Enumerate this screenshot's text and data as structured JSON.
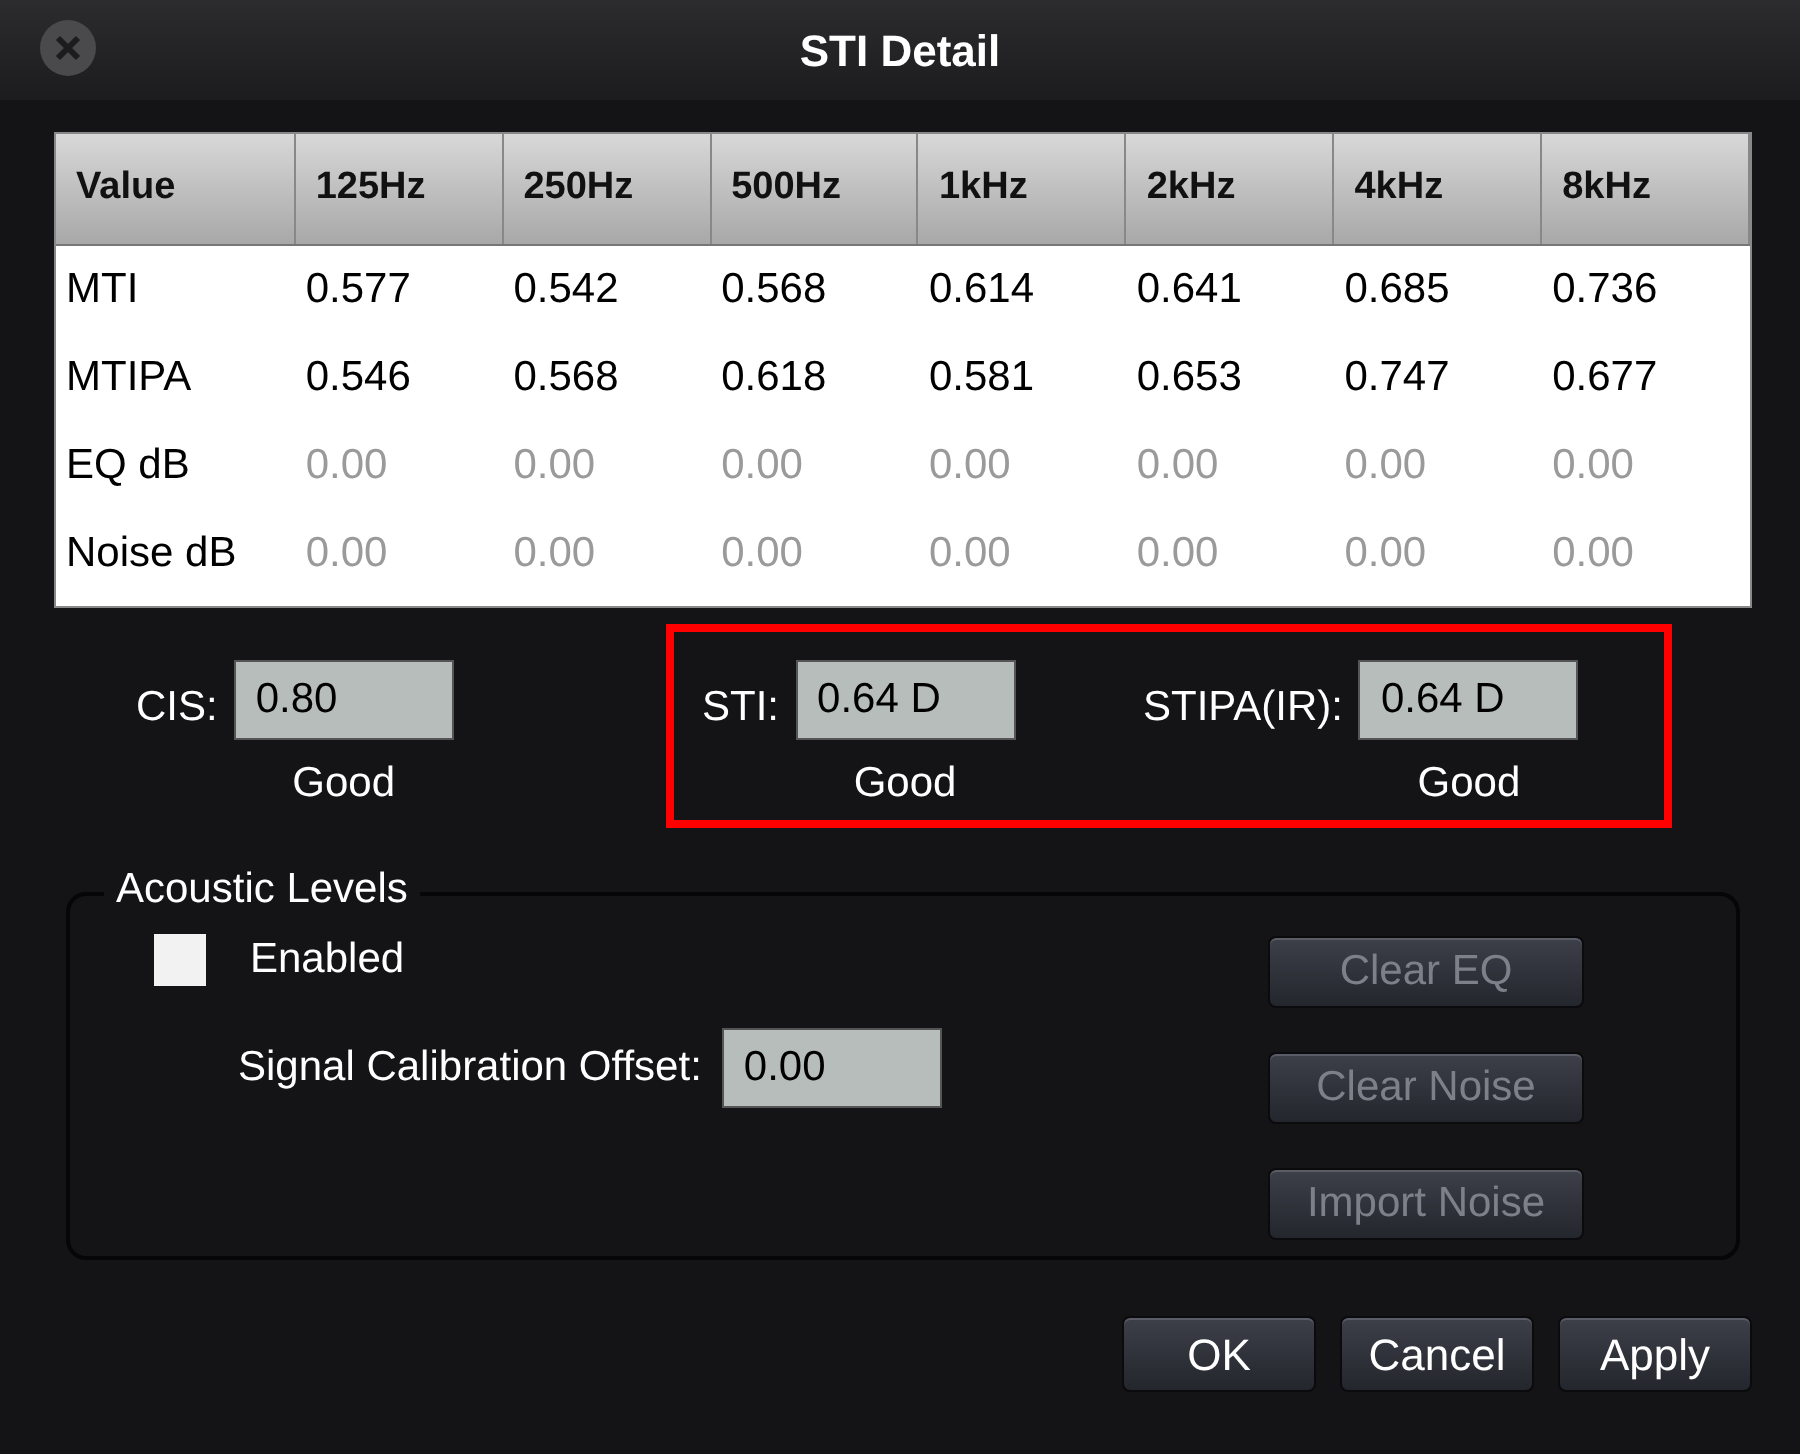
{
  "window": {
    "title": "STI Detail"
  },
  "table": {
    "columns": [
      "Value",
      "125Hz",
      "250Hz",
      "500Hz",
      "1kHz",
      "2kHz",
      "4kHz",
      "8kHz"
    ],
    "rows": [
      {
        "disabled": false,
        "cells": [
          "MTI",
          "0.577",
          "0.542",
          "0.568",
          "0.614",
          "0.641",
          "0.685",
          "0.736"
        ]
      },
      {
        "disabled": false,
        "cells": [
          "MTIPA",
          "0.546",
          "0.568",
          "0.618",
          "0.581",
          "0.653",
          "0.747",
          "0.677"
        ]
      },
      {
        "disabled": true,
        "cells": [
          "EQ dB",
          "0.00",
          "0.00",
          "0.00",
          "0.00",
          "0.00",
          "0.00",
          "0.00"
        ]
      },
      {
        "disabled": true,
        "cells": [
          "Noise dB",
          "0.00",
          "0.00",
          "0.00",
          "0.00",
          "0.00",
          "0.00",
          "0.00"
        ]
      }
    ]
  },
  "metric_groups": [
    {
      "highlighted": false,
      "items": [
        {
          "label": "CIS:",
          "value": "0.80",
          "rating": "Good"
        }
      ]
    },
    {
      "highlighted": true,
      "items": [
        {
          "label": "STI:",
          "value": "0.64 D",
          "rating": "Good"
        },
        {
          "label": "STIPA(IR):",
          "value": "0.64 D",
          "rating": "Good"
        }
      ]
    }
  ],
  "acoustic_levels": {
    "title": "Acoustic Levels",
    "enabled": {
      "label": "Enabled",
      "checked": false
    },
    "offset": {
      "label": "Signal Calibration Offset:",
      "value": "0.00"
    },
    "buttons": [
      {
        "label": "Clear EQ",
        "disabled": true
      },
      {
        "label": "Clear Noise",
        "disabled": true
      },
      {
        "label": "Import Noise",
        "disabled": true
      }
    ]
  },
  "buttons": [
    {
      "label": "OK",
      "disabled": false
    },
    {
      "label": "Cancel",
      "disabled": false
    },
    {
      "label": "Apply",
      "disabled": false
    }
  ]
}
